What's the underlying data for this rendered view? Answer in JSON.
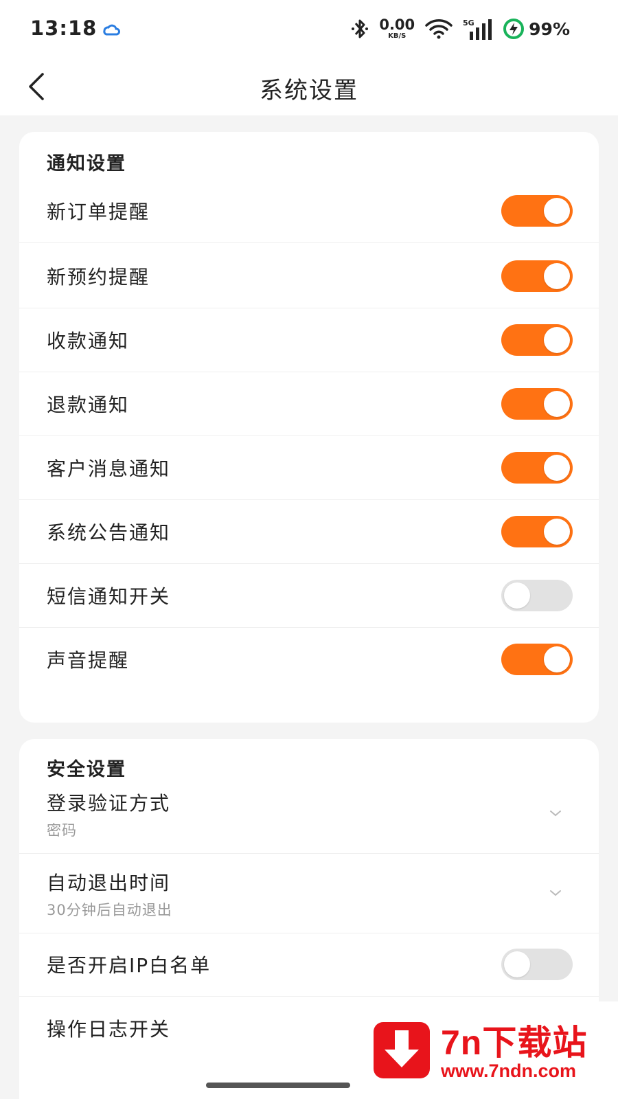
{
  "status_bar": {
    "time": "13:18",
    "net_speed_value": "0.00",
    "net_speed_unit": "KB/S",
    "signal_label": "5G",
    "battery": "99%",
    "icons": [
      "cloud-icon",
      "bluetooth-icon",
      "wifi-icon",
      "signal-icon",
      "battery-charging-icon"
    ]
  },
  "header": {
    "title": "系统设置",
    "back_icon": "chevron-left-icon"
  },
  "notify_section": {
    "title": "通知设置",
    "items": [
      {
        "label": "新订单提醒",
        "enabled": true
      },
      {
        "label": "新预约提醒",
        "enabled": true
      },
      {
        "label": "收款通知",
        "enabled": true
      },
      {
        "label": "退款通知",
        "enabled": true
      },
      {
        "label": "客户消息通知",
        "enabled": true
      },
      {
        "label": "系统公告通知",
        "enabled": true
      },
      {
        "label": "短信通知开关",
        "enabled": false
      },
      {
        "label": "声音提醒",
        "enabled": true
      }
    ]
  },
  "security_section": {
    "title": "安全设置",
    "login_method": {
      "label": "登录验证方式",
      "value": "密码"
    },
    "auto_logout": {
      "label": "自动退出时间",
      "value": "30分钟后自动退出"
    },
    "ip_whitelist": {
      "label": "是否开启IP白名单",
      "enabled": false
    },
    "op_log": {
      "label": "操作日志开关"
    }
  },
  "watermark": {
    "text": "7n下载站",
    "url": "www.7ndn.com"
  },
  "colors": {
    "accent": "#ff7213",
    "toggle_off": "#e2e2e2",
    "background": "#f4f4f4",
    "watermark_red": "#e8141b"
  }
}
